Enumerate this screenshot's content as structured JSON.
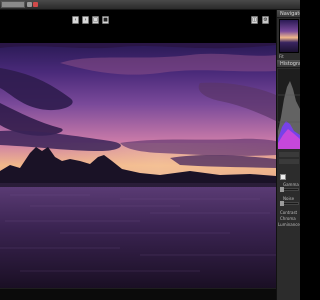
{
  "panels": {
    "navigator_title": "Navigator",
    "navigator_zoom": "Fit",
    "histogram_title": "Histogram"
  },
  "adjustments": {
    "label_1": "Gamma",
    "label_2": "Noise",
    "label_3": "Contrast",
    "label_4": "Chroma",
    "label_5": "Luminance"
  },
  "colors": {
    "accent": "#d04a4a",
    "panel_bg": "#2c2c2c"
  },
  "icons": [
    "undo-icon",
    "redo-icon",
    "crop-icon",
    "save-icon",
    "compare-icon",
    "settings-icon"
  ]
}
